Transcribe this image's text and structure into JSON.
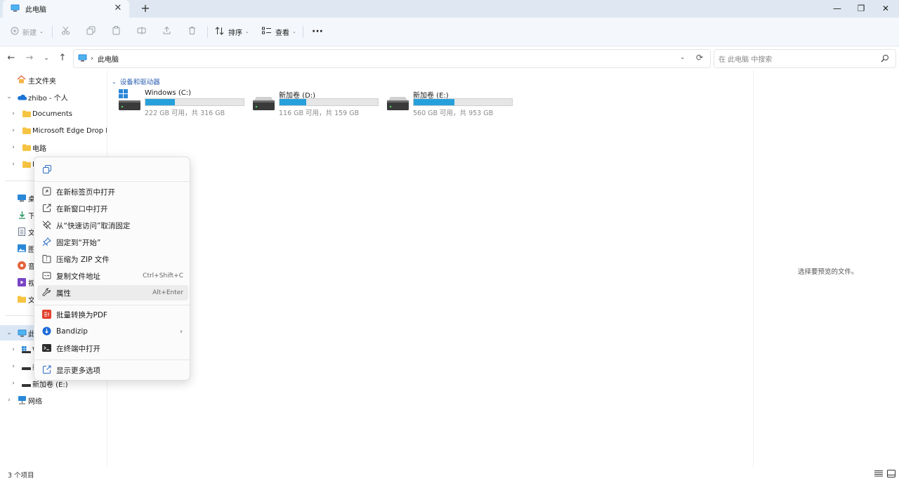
{
  "tab": {
    "title": "此电脑",
    "close": "✕",
    "add": "+"
  },
  "window": {
    "minimize": "—",
    "restore": "❐",
    "close": "✕"
  },
  "toolbar": {
    "new_label": "新建",
    "sort_label": "排序",
    "view_label": "查看",
    "more_label": "···"
  },
  "address": {
    "location": "此电脑",
    "separator": "›"
  },
  "search": {
    "placeholder": "在 此电脑 中搜索"
  },
  "sidebar": {
    "home": "主文件夹",
    "onedrive": "zhibo - 个人",
    "folders": [
      "Documents",
      "Microsoft Edge Drop Files",
      "电路",
      "I"
    ],
    "quick": [
      "桌",
      "下",
      "文",
      "图",
      "音",
      "视",
      "文"
    ],
    "this_pc": "此",
    "drives": [
      "W",
      "新",
      "新加卷 (E:)"
    ],
    "network": "网络"
  },
  "content": {
    "group_title": "设备和驱动器",
    "drives": [
      {
        "name": "Windows (C:)",
        "info": "222 GB 可用，共 316 GB",
        "used_fraction": 0.297,
        "icon": "windows-drive-icon"
      },
      {
        "name": "新加卷 (D:)",
        "info": "116 GB 可用，共 159 GB",
        "used_fraction": 0.27,
        "icon": "hdd-icon"
      },
      {
        "name": "新加卷 (E:)",
        "info": "560 GB 可用，共 953 GB",
        "used_fraction": 0.412,
        "icon": "hdd-icon"
      }
    ],
    "preview_hint": "选择要预览的文件。"
  },
  "status": {
    "items": "3 个项目"
  },
  "context_menu": {
    "items": [
      {
        "label": "在新标签页中打开",
        "icon": "new-tab-icon"
      },
      {
        "label": "在新窗口中打开",
        "icon": "new-window-icon"
      },
      {
        "label": "从“快速访问”取消固定",
        "icon": "unpin-icon"
      },
      {
        "label": "固定到“开始”",
        "icon": "pin-icon"
      },
      {
        "label": "压缩为 ZIP 文件",
        "icon": "zip-icon"
      },
      {
        "label": "复制文件地址",
        "shortcut": "Ctrl+Shift+C",
        "icon": "copy-path-icon"
      },
      {
        "label": "属性",
        "shortcut": "Alt+Enter",
        "icon": "wrench-icon"
      },
      {
        "label": "批量转换为PDF",
        "icon": "pdf-icon"
      },
      {
        "label": "Bandizip",
        "submenu": "›",
        "icon": "bandizip-icon"
      },
      {
        "label": "在终端中打开",
        "icon": "terminal-icon"
      },
      {
        "label": "显示更多选项",
        "icon": "more-options-icon"
      }
    ]
  },
  "colors": {
    "accent": "#26a0da",
    "link_blue": "#2a5db0",
    "folder_yellow": "#f6c443",
    "titlebar_bg": "#dfe8f2",
    "selection": "#dbe7f5"
  }
}
